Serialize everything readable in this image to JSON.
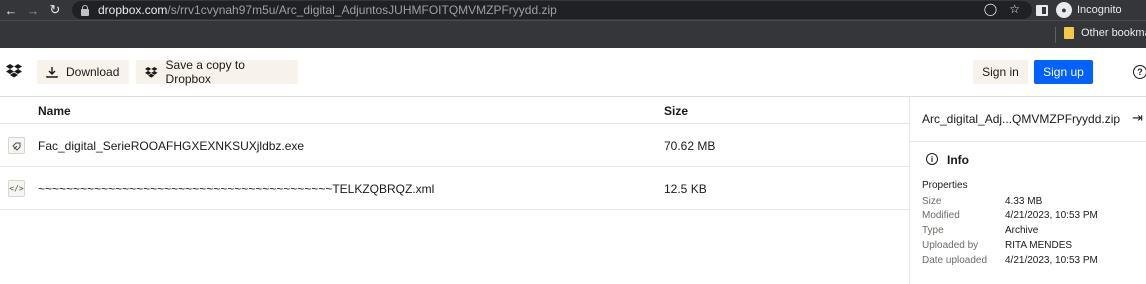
{
  "browser": {
    "url_host": "dropbox.com",
    "url_path": "/s/rrv1cvynah97m5u/Arc_digital_AdjuntosJUHMFOITQMVMZPFryydd.zip",
    "profile_label": "Incognito",
    "bookmark_label": "Other bookmarks"
  },
  "header": {
    "download_label": "Download",
    "save_label": "Save a copy to Dropbox",
    "signin_label": "Sign in",
    "signup_label": "Sign up",
    "brand_color": "#0061fe"
  },
  "table": {
    "headers": {
      "name": "Name",
      "size": "Size"
    },
    "rows": [
      {
        "icon": "executable-icon",
        "name": "Fac_digital_SerieROOAFHGXEXNKSUXjldbz.exe",
        "size": "70.62 MB"
      },
      {
        "icon": "xml-code-icon",
        "name": "~~~~~~~~~~~~~~~~~~~~~~~~~~~~~~~~~~~~~~~~~~TELKZQBRQZ.xml",
        "size": "12.5 KB"
      }
    ]
  },
  "panel": {
    "title": "Arc_digital_Adj...QMVMZPFryydd.zip",
    "info_label": "Info",
    "properties_title": "Properties",
    "properties": [
      {
        "key": "Size",
        "value": "4.33 MB"
      },
      {
        "key": "Modified",
        "value": "4/21/2023, 10:53 PM"
      },
      {
        "key": "Type",
        "value": "Archive"
      },
      {
        "key": "Uploaded by",
        "value": "RITA MENDES"
      },
      {
        "key": "Date uploaded",
        "value": "4/21/2023, 10:53 PM"
      }
    ]
  }
}
